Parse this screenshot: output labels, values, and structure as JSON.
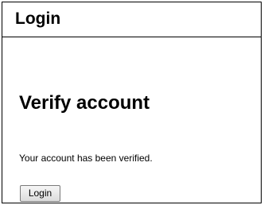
{
  "window": {
    "title": "Login"
  },
  "main": {
    "heading": "Verify account",
    "message": "Your account has been verified.",
    "login_button_label": "Login"
  }
}
